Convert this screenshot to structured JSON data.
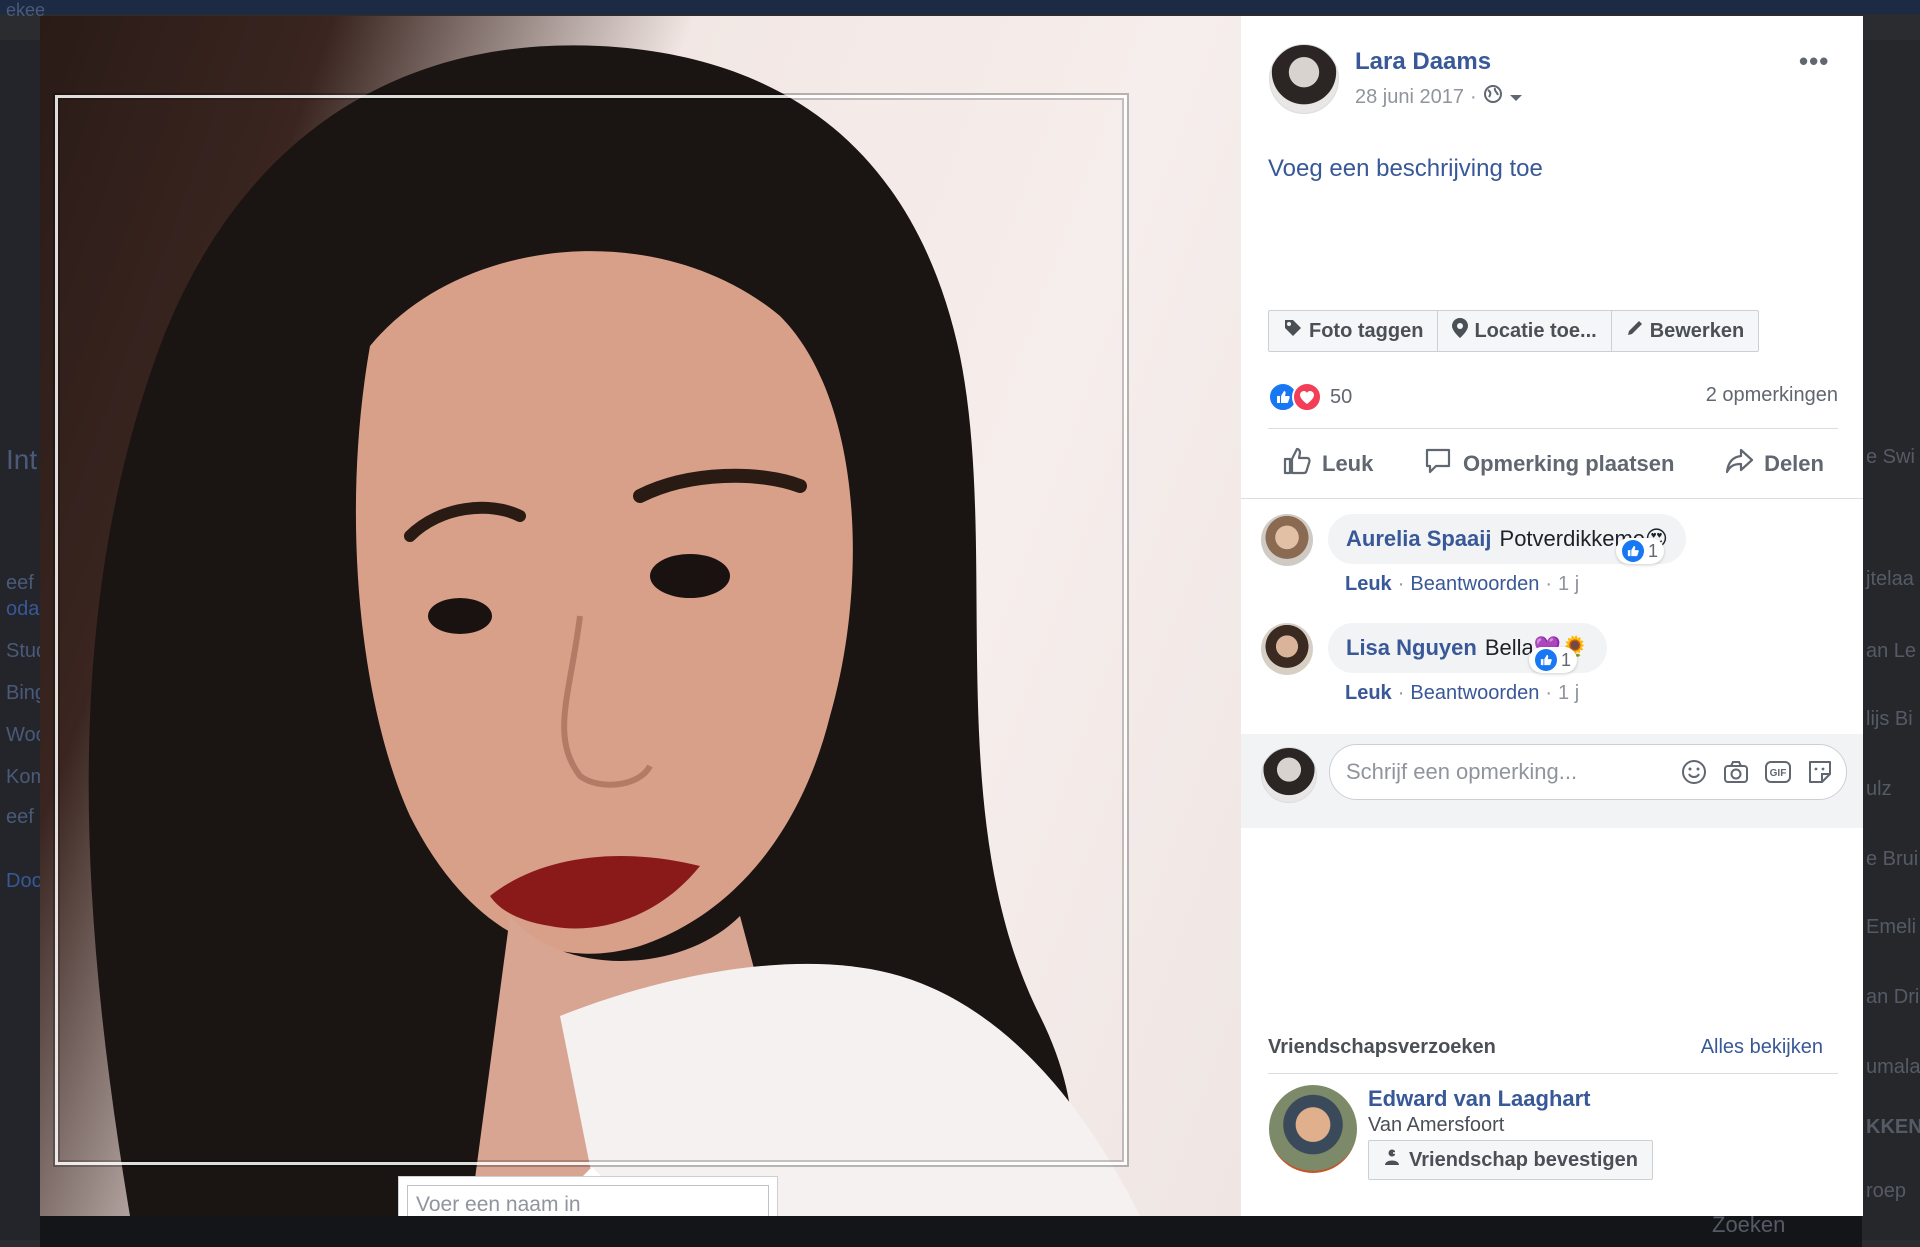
{
  "background": {
    "left_fragments": [
      "ekee",
      "Int",
      "eef",
      "oda",
      "Stud",
      "Bing",
      "Woon",
      "Komt",
      "eef",
      "Door"
    ],
    "right_fragments": [
      "e Swi",
      "jtelaa",
      "an Le",
      "lijs Bi",
      "ulz",
      "e Brui",
      "Emeli",
      "an Dri",
      "umala",
      "KKEN",
      "roep",
      "Zoeken"
    ]
  },
  "photo": {
    "tag_input_placeholder": "Voer een naam in"
  },
  "post": {
    "author": "Lara Daams",
    "date": "28 juni 2017",
    "more": "•••",
    "description_link": "Voeg een beschrijving toe",
    "buttons": {
      "tag": "Foto taggen",
      "location": "Locatie toe...",
      "edit": "Bewerken"
    },
    "reaction_count": "50",
    "comment_count": "2 opmerkingen",
    "actions": {
      "like": "Leuk",
      "comment": "Opmerking plaatsen",
      "share": "Delen"
    }
  },
  "comments": [
    {
      "name": "Aurelia Spaaij",
      "text": "Potverdikkeme",
      "emoji": "😍",
      "likes": "1",
      "like_label": "Leuk",
      "reply_label": "Beantwoorden",
      "time": "1 j"
    },
    {
      "name": "Lisa Nguyen",
      "text": "Bella",
      "emoji": "💜🌻",
      "likes": "1",
      "like_label": "Leuk",
      "reply_label": "Beantwoorden",
      "time": "1 j"
    }
  ],
  "write_comment": {
    "placeholder": "Schrijf een opmerking..."
  },
  "friend_requests": {
    "title": "Vriendschapsverzoeken",
    "see_all": "Alles bekijken",
    "name": "Edward van Laaghart",
    "location": "Van Amersfoort",
    "confirm": "Vriendschap bevestigen"
  },
  "colors": {
    "link": "#385898",
    "like_blue": "#1877f2",
    "love_red": "#f33e58"
  }
}
